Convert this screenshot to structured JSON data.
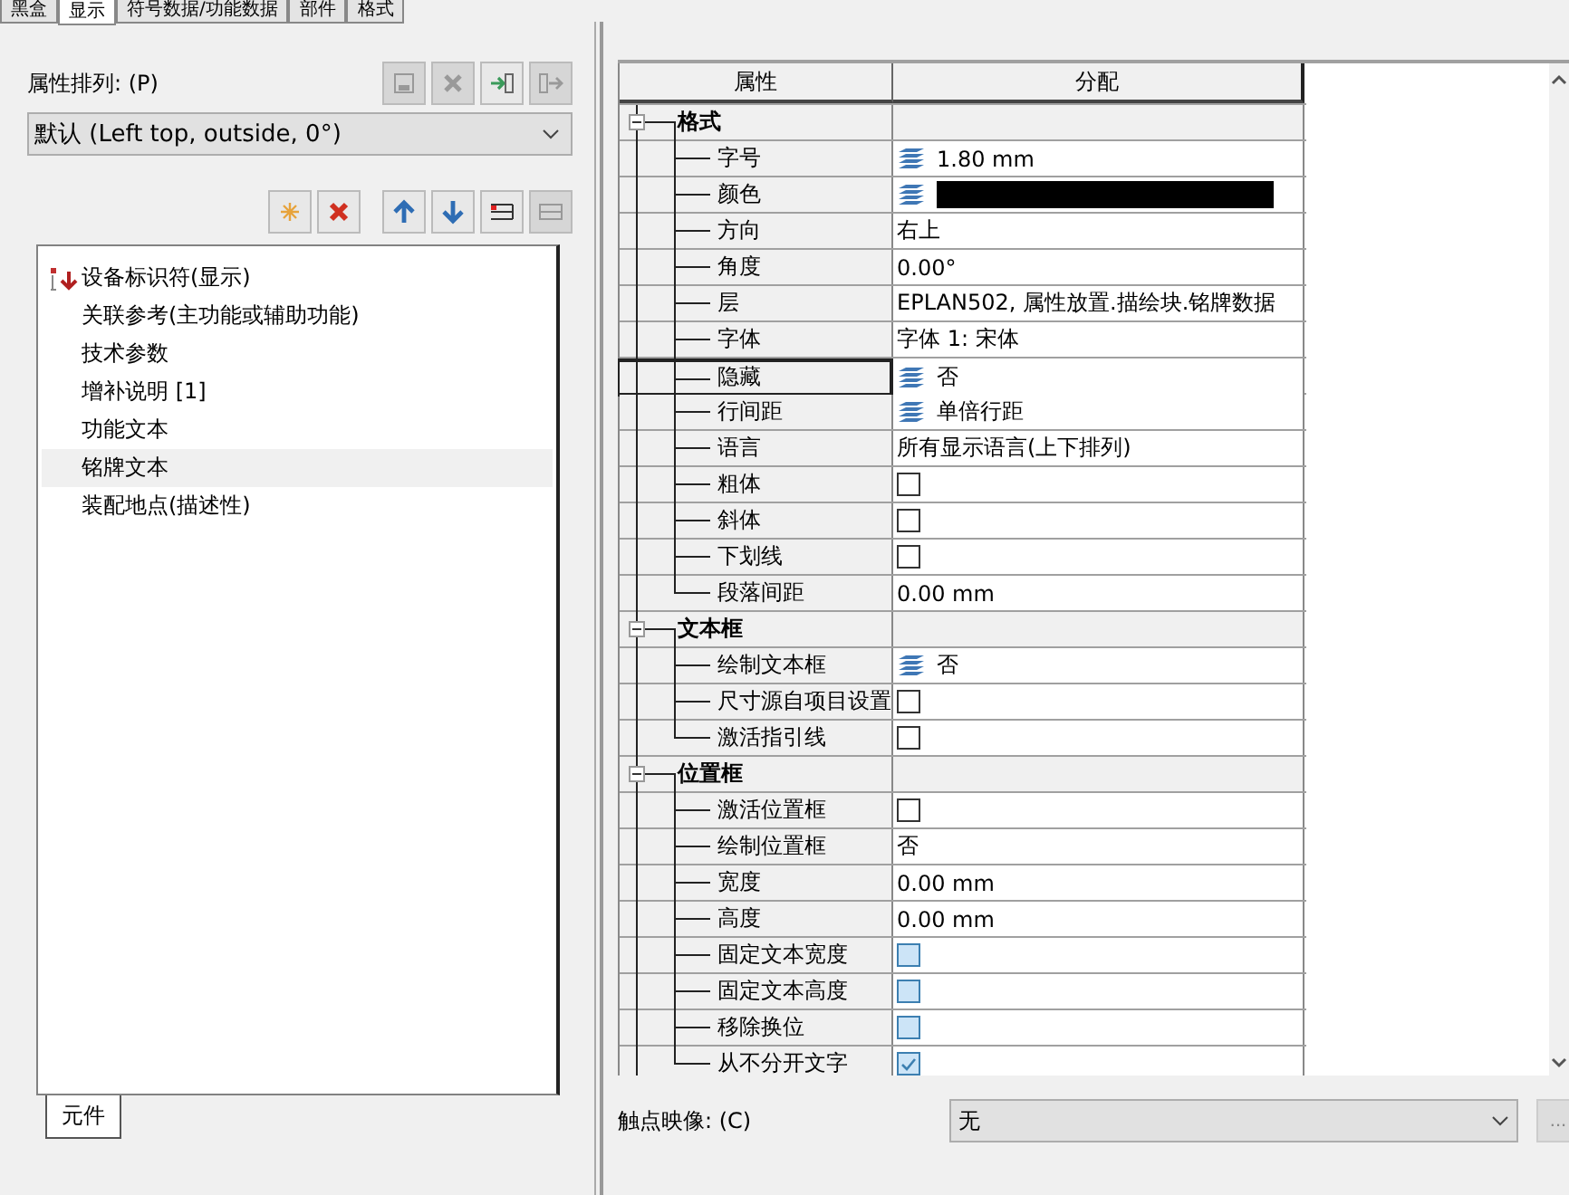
{
  "tabs": [
    {
      "label": "黑盒",
      "selected": false
    },
    {
      "label": "显示",
      "selected": true
    },
    {
      "label": "符号数据/功能数据",
      "selected": false
    },
    {
      "label": "部件",
      "selected": false
    },
    {
      "label": "格式",
      "selected": false
    }
  ],
  "arrangement": {
    "label": "属性排列: (P)",
    "value": "默认 (Left top, outside, 0°)"
  },
  "items": [
    {
      "label": "设备标识符(显示)",
      "selected": false,
      "marked": true
    },
    {
      "label": "关联参考(主功能或辅助功能)",
      "selected": false,
      "marked": false
    },
    {
      "label": "技术参数",
      "selected": false,
      "marked": false
    },
    {
      "label": "增补说明 [1]",
      "selected": false,
      "marked": false
    },
    {
      "label": "功能文本",
      "selected": false,
      "marked": false
    },
    {
      "label": "铭牌文本",
      "selected": true,
      "marked": false
    },
    {
      "label": "装配地点(描述性)",
      "selected": false,
      "marked": false
    }
  ],
  "bottom_tab": {
    "label": "元件"
  },
  "grid": {
    "columns": [
      "属性",
      "分配"
    ],
    "groups": [
      {
        "label": "格式",
        "expanded": true,
        "rows": [
          {
            "label": "字号",
            "kind": "layered",
            "value": "1.80 mm",
            "selected": false
          },
          {
            "label": "颜色",
            "kind": "color",
            "color": "#000000",
            "selected": false
          },
          {
            "label": "方向",
            "kind": "text",
            "value": "右上",
            "selected": false
          },
          {
            "label": "角度",
            "kind": "text",
            "value": "0.00°",
            "selected": false
          },
          {
            "label": "层",
            "kind": "text",
            "value": "EPLAN502, 属性放置.描绘块.铭牌数据",
            "selected": false
          },
          {
            "label": "字体",
            "kind": "text",
            "value": "字体 1: 宋体",
            "selected": false
          },
          {
            "label": "隐藏",
            "kind": "layered",
            "value": "否",
            "selected": true
          },
          {
            "label": "行间距",
            "kind": "layered",
            "value": "单倍行距",
            "selected": false
          },
          {
            "label": "语言",
            "kind": "text",
            "value": "所有显示语言(上下排列)",
            "selected": false
          },
          {
            "label": "粗体",
            "kind": "checkbox",
            "checked": false,
            "disabled": false,
            "selected": false
          },
          {
            "label": "斜体",
            "kind": "checkbox",
            "checked": false,
            "disabled": false,
            "selected": false
          },
          {
            "label": "下划线",
            "kind": "checkbox",
            "checked": false,
            "disabled": false,
            "selected": false
          },
          {
            "label": "段落间距",
            "kind": "text",
            "value": "0.00 mm",
            "selected": false
          }
        ]
      },
      {
        "label": "文本框",
        "expanded": true,
        "rows": [
          {
            "label": "绘制文本框",
            "kind": "layered",
            "value": "否",
            "selected": false
          },
          {
            "label": "尺寸源自项目设置",
            "kind": "checkbox",
            "checked": false,
            "disabled": false,
            "selected": false
          },
          {
            "label": "激活指引线",
            "kind": "checkbox",
            "checked": false,
            "disabled": false,
            "selected": false
          }
        ]
      },
      {
        "label": "位置框",
        "expanded": true,
        "rows": [
          {
            "label": "激活位置框",
            "kind": "checkbox",
            "checked": false,
            "disabled": false,
            "selected": false
          },
          {
            "label": "绘制位置框",
            "kind": "text",
            "value": "否",
            "selected": false
          },
          {
            "label": "宽度",
            "kind": "text",
            "value": "0.00 mm",
            "selected": false
          },
          {
            "label": "高度",
            "kind": "text",
            "value": "0.00 mm",
            "selected": false
          },
          {
            "label": "固定文本宽度",
            "kind": "checkbox",
            "checked": false,
            "disabled": true,
            "selected": false
          },
          {
            "label": "固定文本高度",
            "kind": "checkbox",
            "checked": false,
            "disabled": true,
            "selected": false
          },
          {
            "label": "移除换位",
            "kind": "checkbox",
            "checked": false,
            "disabled": true,
            "selected": false
          },
          {
            "label": "从不分开文字",
            "kind": "checkbox",
            "checked": true,
            "disabled": true,
            "selected": false
          }
        ]
      }
    ]
  },
  "contact_image": {
    "label": "触点映像: (C)",
    "value": "无",
    "button": "..."
  }
}
